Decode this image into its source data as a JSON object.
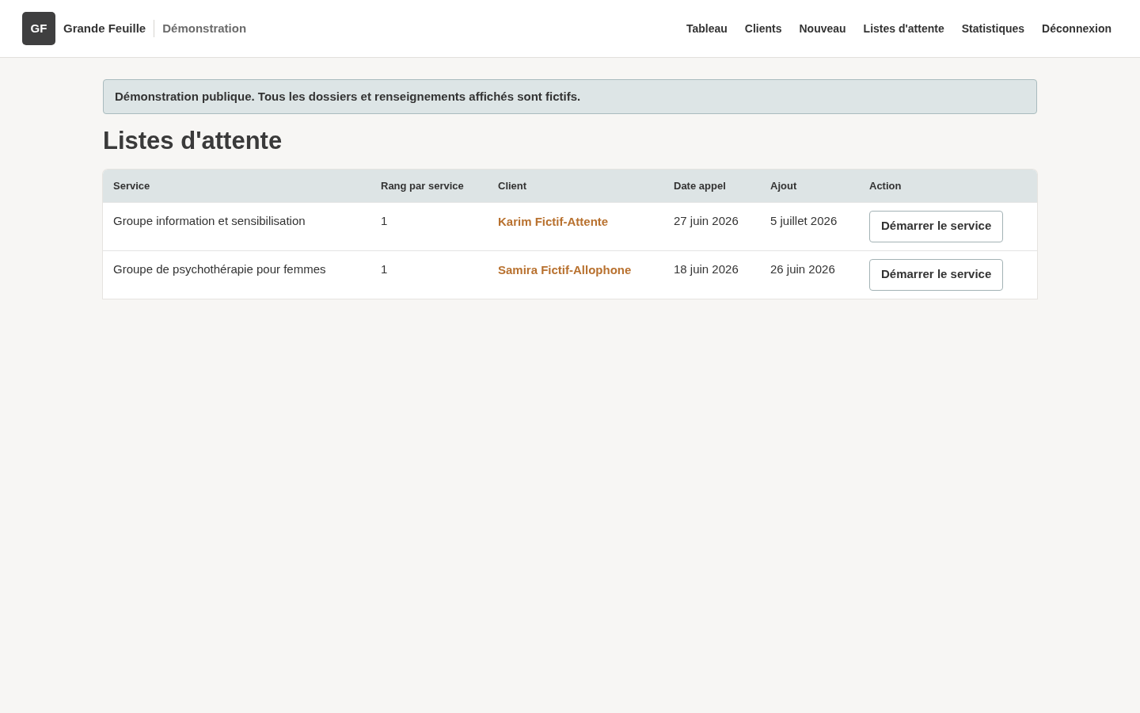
{
  "header": {
    "logo": "GF",
    "brand": "Grande Feuille",
    "subtitle": "Démonstration",
    "nav": [
      "Tableau",
      "Clients",
      "Nouveau",
      "Listes d'attente",
      "Statistiques",
      "Déconnexion"
    ]
  },
  "notice": "Démonstration publique. Tous les dossiers et renseignements affichés sont fictifs.",
  "title": "Listes d'attente",
  "table": {
    "columns": [
      "Service",
      "Rang par service",
      "Client",
      "Date appel",
      "Ajout",
      "Action"
    ],
    "rows": [
      {
        "service": "Groupe information et sensibilisation",
        "rank": "1",
        "client": "Karim Fictif-Attente",
        "call_date": "27 juin 2026",
        "added": "5 juillet 2026",
        "action": "Démarrer le service"
      },
      {
        "service": "Groupe de psychothérapie pour femmes",
        "rank": "1",
        "client": "Samira Fictif-Allophone",
        "call_date": "18 juin 2026",
        "added": "26 juin 2026",
        "action": "Démarrer le service"
      }
    ]
  }
}
